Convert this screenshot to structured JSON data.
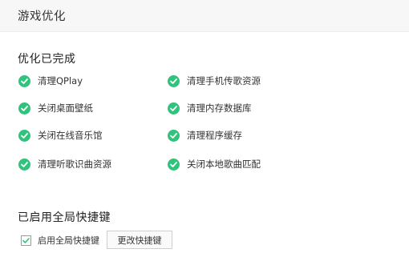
{
  "window": {
    "title": "游戏优化"
  },
  "optimization": {
    "heading": "优化已完成",
    "items": [
      {
        "label": "清理QPlay"
      },
      {
        "label": "清理手机传歌资源"
      },
      {
        "label": "关闭桌面壁纸"
      },
      {
        "label": "清理内存数据库"
      },
      {
        "label": "关闭在线音乐馆"
      },
      {
        "label": "清理程序缓存"
      },
      {
        "label": "清理听歌识曲资源"
      },
      {
        "label": "关闭本地歌曲匹配"
      }
    ],
    "check_icon": "check-circle-icon",
    "accent_color": "#31c27c"
  },
  "hotkeys": {
    "heading": "已启用全局快捷键",
    "checkbox_label": "启用全局快捷键",
    "checkbox_checked": true,
    "change_button_label": "更改快捷键"
  }
}
